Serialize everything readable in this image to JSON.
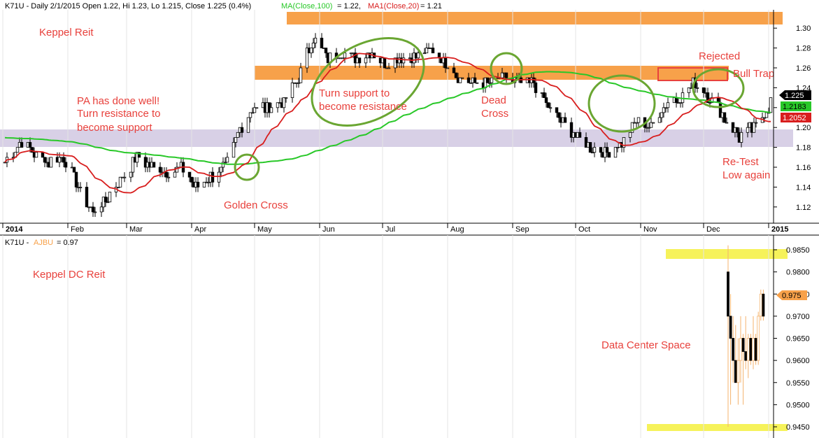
{
  "header": {
    "top_prefix": "K71U - Daily 2/1/2015 Open 1.22, Hi 1.23, Lo 1.215, Close 1.225 (0.4%)",
    "ma100": "MA(Close,100) = 1.22,",
    "ma20": "MA1(Close,20) = 1.21",
    "bottom_prefix": "K71U -",
    "bottom_series": "AJBU",
    "bottom_value": "= 0.97"
  },
  "colors": {
    "accent_orange": "#f7a14a",
    "support_purple": "#d8d0e6",
    "ma100_green": "#28c828",
    "ma20_red": "#d81e1e",
    "annotation_red": "#e8413c",
    "oval_green": "#6aa632",
    "highlight_yellow": "#f6f25a"
  },
  "chart_data": [
    {
      "type": "candlestick",
      "title": "Keppel Reit",
      "xlabel": "",
      "ylabel": "",
      "x_ticks": [
        "2014",
        "Feb",
        "Mar",
        "Apr",
        "May",
        "Jun",
        "Jul",
        "Aug",
        "Sep",
        "Oct",
        "Nov",
        "Dec",
        "2015"
      ],
      "y_ticks": [
        "1.12",
        "1.14",
        "1.16",
        "1.18",
        "1.20",
        "1.22",
        "1.24",
        "1.26",
        "1.28",
        "1.30"
      ],
      "ylim": [
        1.105,
        1.31
      ],
      "price_close": [
        {
          "date": "2014-01-02",
          "v": 1.165
        },
        {
          "date": "2014-01-09",
          "v": 1.185
        },
        {
          "date": "2014-01-16",
          "v": 1.175
        },
        {
          "date": "2014-01-23",
          "v": 1.165
        },
        {
          "date": "2014-01-30",
          "v": 1.17
        },
        {
          "date": "2014-02-06",
          "v": 1.14
        },
        {
          "date": "2014-02-13",
          "v": 1.115
        },
        {
          "date": "2014-02-20",
          "v": 1.13
        },
        {
          "date": "2014-02-27",
          "v": 1.15
        },
        {
          "date": "2014-03-06",
          "v": 1.17
        },
        {
          "date": "2014-03-13",
          "v": 1.16
        },
        {
          "date": "2014-03-20",
          "v": 1.155
        },
        {
          "date": "2014-03-27",
          "v": 1.16
        },
        {
          "date": "2014-04-03",
          "v": 1.14
        },
        {
          "date": "2014-04-10",
          "v": 1.15
        },
        {
          "date": "2014-04-17",
          "v": 1.16
        },
        {
          "date": "2014-04-24",
          "v": 1.2
        },
        {
          "date": "2014-05-01",
          "v": 1.22
        },
        {
          "date": "2014-05-08",
          "v": 1.22
        },
        {
          "date": "2014-05-15",
          "v": 1.225
        },
        {
          "date": "2014-05-22",
          "v": 1.25
        },
        {
          "date": "2014-05-29",
          "v": 1.29
        },
        {
          "date": "2014-06-05",
          "v": 1.27
        },
        {
          "date": "2014-06-12",
          "v": 1.275
        },
        {
          "date": "2014-06-19",
          "v": 1.27
        },
        {
          "date": "2014-06-26",
          "v": 1.275
        },
        {
          "date": "2014-07-03",
          "v": 1.265
        },
        {
          "date": "2014-07-10",
          "v": 1.27
        },
        {
          "date": "2014-07-17",
          "v": 1.27
        },
        {
          "date": "2014-07-24",
          "v": 1.28
        },
        {
          "date": "2014-07-31",
          "v": 1.265
        },
        {
          "date": "2014-08-07",
          "v": 1.25
        },
        {
          "date": "2014-08-14",
          "v": 1.245
        },
        {
          "date": "2014-08-21",
          "v": 1.245
        },
        {
          "date": "2014-08-28",
          "v": 1.25
        },
        {
          "date": "2014-09-04",
          "v": 1.245
        },
        {
          "date": "2014-09-11",
          "v": 1.245
        },
        {
          "date": "2014-09-18",
          "v": 1.22
        },
        {
          "date": "2014-09-25",
          "v": 1.205
        },
        {
          "date": "2014-10-02",
          "v": 1.19
        },
        {
          "date": "2014-10-09",
          "v": 1.18
        },
        {
          "date": "2014-10-16",
          "v": 1.175
        },
        {
          "date": "2014-10-23",
          "v": 1.185
        },
        {
          "date": "2014-10-30",
          "v": 1.205
        },
        {
          "date": "2014-11-06",
          "v": 1.2
        },
        {
          "date": "2014-11-13",
          "v": 1.225
        },
        {
          "date": "2014-11-20",
          "v": 1.23
        },
        {
          "date": "2014-11-27",
          "v": 1.245
        },
        {
          "date": "2014-12-04",
          "v": 1.23
        },
        {
          "date": "2014-12-11",
          "v": 1.21
        },
        {
          "date": "2014-12-18",
          "v": 1.19
        },
        {
          "date": "2014-12-25",
          "v": 1.2
        },
        {
          "date": "2015-01-02",
          "v": 1.225
        }
      ],
      "series": [
        {
          "name": "MA(Close,100)",
          "last": "1.2183",
          "color": "#28c828"
        },
        {
          "name": "MA1(Close,20)",
          "last": "1.2052",
          "color": "#d81e1e"
        }
      ],
      "last_price_tag": "1.225",
      "ma100_tag": "1.2183",
      "ma20_tag": "1.2052",
      "zones": [
        {
          "low": 1.296,
          "high": 1.303,
          "color": "#f7a14a"
        },
        {
          "low": 1.24,
          "high": 1.246,
          "color": "#f7a14a"
        },
        {
          "low": 1.177,
          "high": 1.193,
          "color": "#d8d0e6"
        }
      ],
      "annotations": [
        "Keppel Reit",
        "PA has done well!",
        "Turn resistance to",
        "become support",
        "Golden Cross",
        "Turn support to",
        "become resistance",
        "Dead",
        "Cross",
        "Rejected",
        "Bull Trap",
        "Re-Test",
        "Low again"
      ]
    },
    {
      "type": "candlestick",
      "title": "Keppel DC Reit",
      "y_ticks": [
        "0.9450",
        "0.9500",
        "0.9550",
        "0.9600",
        "0.9650",
        "0.9700",
        "0.9750",
        "0.9800",
        "0.9850"
      ],
      "ylim": [
        0.944,
        0.987
      ],
      "last_price_tag": "0.975",
      "bars": [
        {
          "o": 0.98,
          "h": 0.986,
          "l": 0.945,
          "c": 0.97
        },
        {
          "o": 0.97,
          "h": 0.975,
          "l": 0.95,
          "c": 0.965
        },
        {
          "o": 0.965,
          "h": 0.97,
          "l": 0.955,
          "c": 0.96
        },
        {
          "o": 0.96,
          "h": 0.968,
          "l": 0.955,
          "c": 0.955
        },
        {
          "o": 0.955,
          "h": 0.965,
          "l": 0.95,
          "c": 0.96
        },
        {
          "o": 0.96,
          "h": 0.97,
          "l": 0.955,
          "c": 0.965
        },
        {
          "o": 0.965,
          "h": 0.966,
          "l": 0.95,
          "c": 0.962
        },
        {
          "o": 0.962,
          "h": 0.97,
          "l": 0.958,
          "c": 0.96
        },
        {
          "o": 0.96,
          "h": 0.966,
          "l": 0.956,
          "c": 0.965
        },
        {
          "o": 0.965,
          "h": 0.966,
          "l": 0.959,
          "c": 0.96
        },
        {
          "o": 0.96,
          "h": 0.97,
          "l": 0.958,
          "c": 0.965
        },
        {
          "o": 0.965,
          "h": 0.966,
          "l": 0.959,
          "c": 0.96
        },
        {
          "o": 0.96,
          "h": 0.971,
          "l": 0.959,
          "c": 0.97
        },
        {
          "o": 0.97,
          "h": 0.976,
          "l": 0.969,
          "c": 0.975
        },
        {
          "o": 0.975,
          "h": 0.976,
          "l": 0.969,
          "c": 0.97
        }
      ],
      "highlight_levels": [
        0.984,
        0.946
      ],
      "annotations": [
        "Keppel DC Reit",
        "Data Center Space"
      ]
    }
  ]
}
